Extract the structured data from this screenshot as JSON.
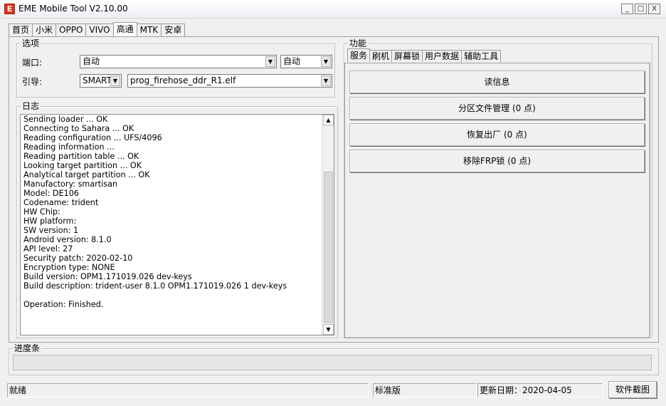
{
  "window": {
    "title": "EME Mobile Tool V2.10.00",
    "app_icon": "E",
    "controls": {
      "minimize": "_",
      "maximize": "□",
      "close": "X"
    }
  },
  "main_tabs": [
    "首页",
    "小米",
    "OPPO",
    "VIVO",
    "高通",
    "MTK",
    "安卓"
  ],
  "active_main_tab": "高通",
  "options": {
    "group_label": "选项",
    "port_label": "端口:",
    "port_value": "自动",
    "port_mode_value": "自动",
    "loader_label": "引导:",
    "loader_type_value": "SMARTI",
    "loader_file_value": "prog_firehose_ddr_R1.elf"
  },
  "log": {
    "group_label": "日志",
    "lines": [
      "Sending loader ... OK",
      "Connecting to Sahara ... OK",
      "Reading configuration ... UFS/4096",
      "Reading information ...",
      "Reading partition table ... OK",
      "Looking target partition ... OK",
      "Analytical target partition ... OK",
      "Manufactory: smartisan",
      "Model: DE106",
      "Codename: trident",
      "HW Chip:",
      "HW platform:",
      "SW version: 1",
      "Android version: 8.1.0",
      "API level: 27",
      "Security patch: 2020-02-10",
      "Encryption type: NONE",
      "Build version: OPM1.171019.026 dev-keys",
      "Build description: trident-user 8.1.0 OPM1.171019.026 1 dev-keys",
      "",
      "Operation: Finished."
    ]
  },
  "functions": {
    "group_label": "功能",
    "tabs": [
      "服务",
      "刷机",
      "屏幕锁",
      "用户数据",
      "辅助工具"
    ],
    "active_tab": "服务",
    "buttons": [
      "读信息",
      "分区文件管理 (0 点)",
      "恢复出厂 (0 点)",
      "移除FRP锁 (0 点)"
    ]
  },
  "progress": {
    "group_label": "进度条",
    "value_percent": 0
  },
  "status": {
    "state": "就绪",
    "edition": "标准版",
    "update_date": "更新日期：2020-04-05",
    "screenshot_button": "软件截图"
  }
}
